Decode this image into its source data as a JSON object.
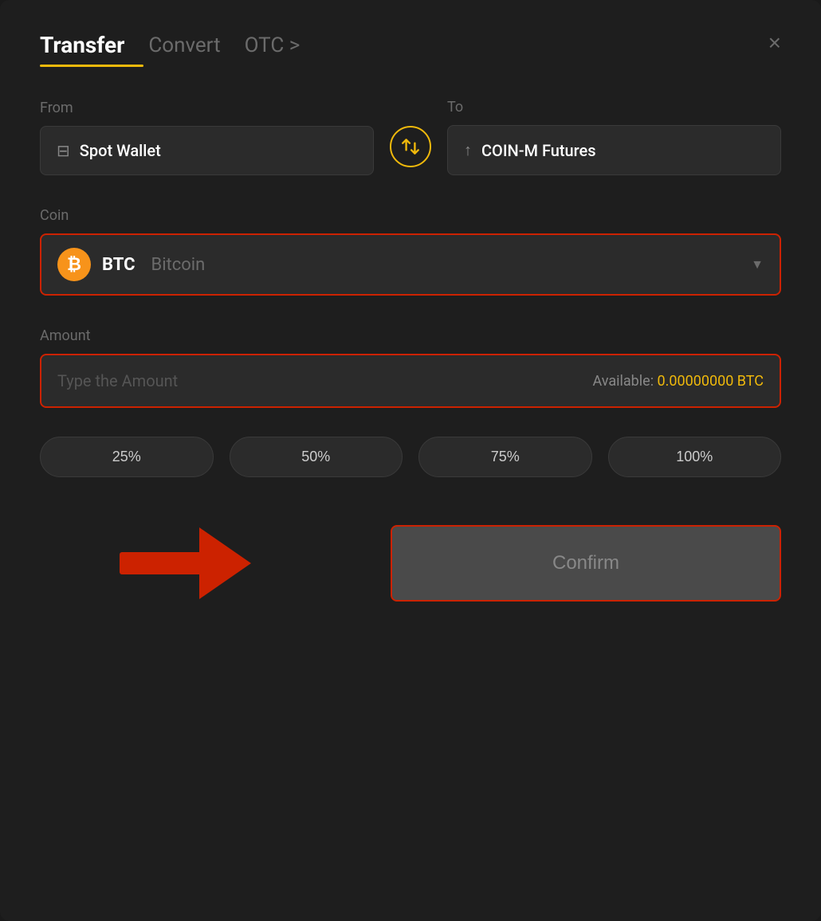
{
  "modal": {
    "title": "Transfer"
  },
  "tabs": {
    "transfer": "Transfer",
    "convert": "Convert",
    "otc": "OTC >"
  },
  "from": {
    "label": "From",
    "wallet": "Spot Wallet"
  },
  "to": {
    "label": "To",
    "wallet": "COIN-M Futures"
  },
  "coin": {
    "label": "Coin",
    "symbol": "BTC",
    "name": "Bitcoin"
  },
  "amount": {
    "label": "Amount",
    "placeholder": "Type the Amount",
    "available_label": "Available:",
    "available_value": "0.00000000 BTC"
  },
  "percentage_buttons": [
    "25%",
    "50%",
    "75%",
    "100%"
  ],
  "confirm_button": "Confirm",
  "close_label": "×"
}
